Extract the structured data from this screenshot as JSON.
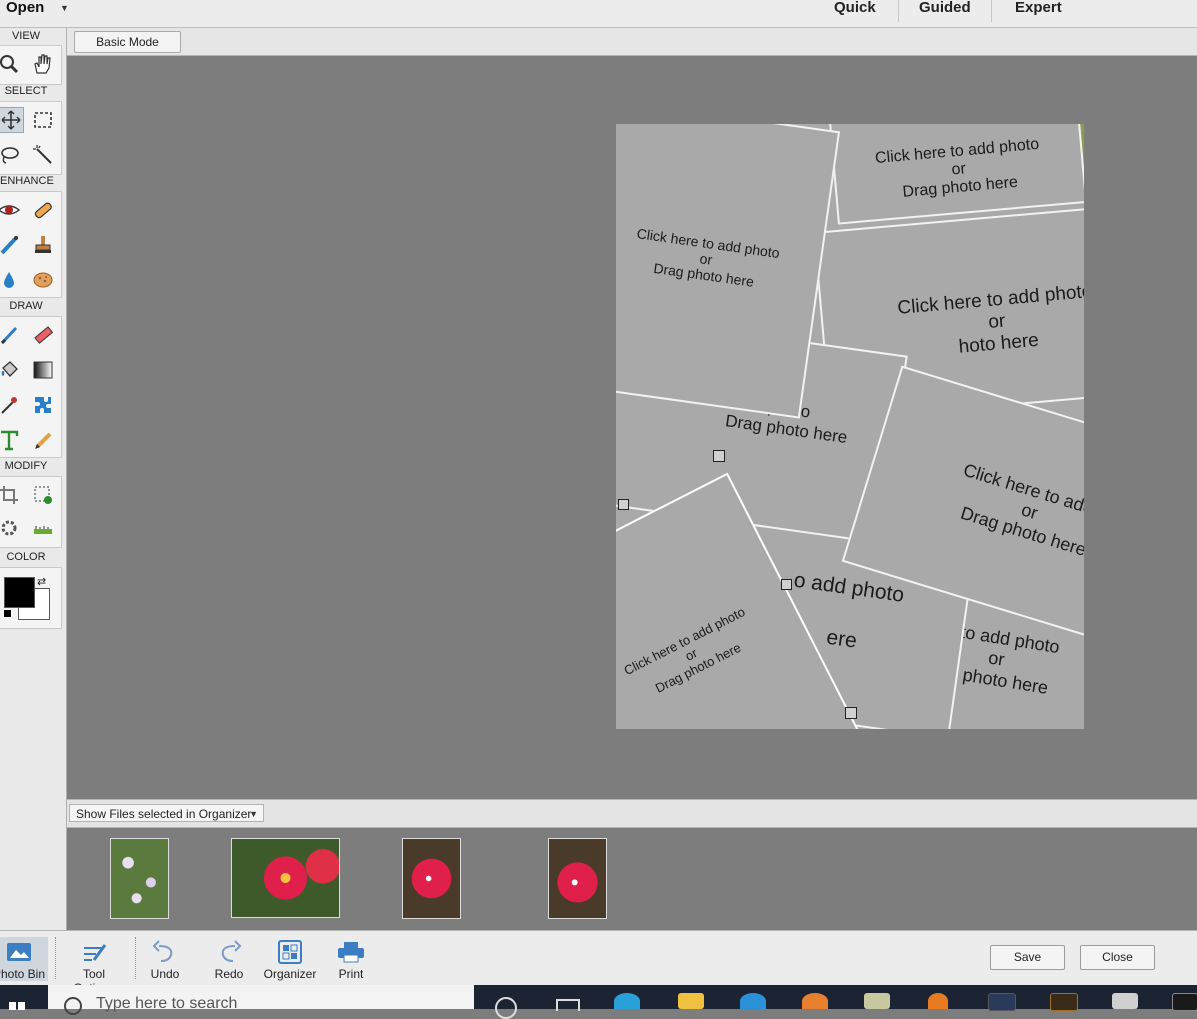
{
  "topbar": {
    "open_label": "Open",
    "modes": [
      "Quick",
      "Guided",
      "Expert"
    ]
  },
  "subbar": {
    "basic_mode_label": "Basic Mode"
  },
  "toolbox": {
    "sections": [
      "VIEW",
      "SELECT",
      "ENHANCE",
      "DRAW",
      "MODIFY",
      "COLOR"
    ],
    "tools": {
      "view": [
        "zoom-tool-icon",
        "hand-tool-icon"
      ],
      "select": [
        "move-tool-icon",
        "marquee-tool-icon",
        "lasso-tool-icon",
        "magic-wand-icon"
      ],
      "enhance": [
        "red-eye-icon",
        "spot-healing-icon",
        "smart-brush-icon",
        "clone-stamp-icon",
        "blur-drop-icon",
        "sponge-icon"
      ],
      "draw": [
        "brush-icon",
        "eraser-icon",
        "paint-bucket-icon",
        "gradient-icon",
        "eyedropper-icon",
        "custom-shape-icon",
        "type-tool-icon",
        "pencil-icon"
      ],
      "modify": [
        "crop-icon",
        "recompose-icon",
        "content-aware-move-icon",
        "straighten-icon"
      ]
    },
    "colors": {
      "foreground": "#000000",
      "background": "#ffffff"
    }
  },
  "canvas": {
    "placeholder_lines": [
      "Click here to add photo",
      "or",
      "Drag photo here"
    ],
    "visible_fragments": {
      "frame_mid": [
        "photo",
        "Drag photo here"
      ],
      "frame_right": [
        "Click here to add p",
        "or",
        "Drag photo here"
      ],
      "frame_lower_mid": [
        "o add photo",
        "ere"
      ],
      "frame_lower_right": [
        "re to add photo",
        "or",
        "ag photo here"
      ],
      "frame_right_top": [
        "Click here to add photo",
        "or",
        "hoto here"
      ]
    }
  },
  "photo_bin": {
    "dropdown_label": "Show Files selected in Organizer",
    "thumbnails": [
      {
        "name": "white-flower-bush"
      },
      {
        "name": "red-flower-closeup"
      },
      {
        "name": "pink-bougainvillea-1"
      },
      {
        "name": "pink-bougainvillea-2"
      }
    ]
  },
  "bottombar": {
    "buttons": [
      "Photo Bin",
      "Tool Options",
      "Undo",
      "Redo",
      "Organizer",
      "Print"
    ],
    "save_label": "Save",
    "close_label": "Close"
  },
  "taskbar": {
    "search_placeholder": "Type here to search"
  }
}
